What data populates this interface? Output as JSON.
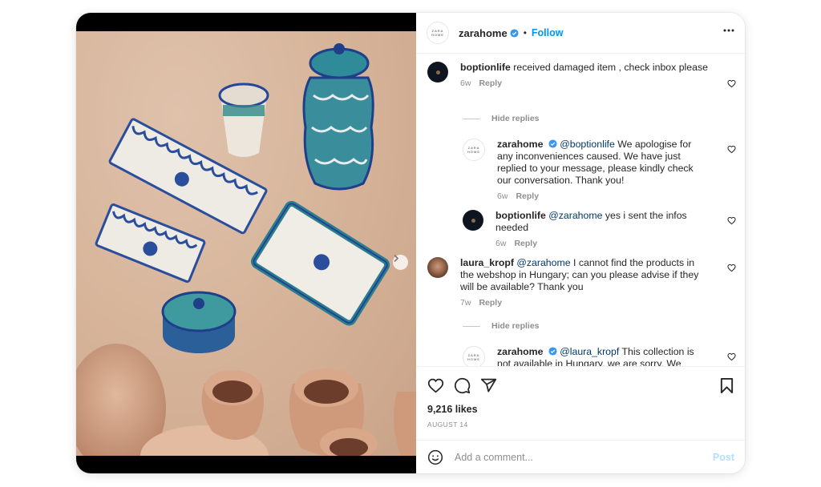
{
  "post": {
    "author": "zarahome",
    "author_avatar_text": [
      "ZARA",
      "HOME"
    ],
    "verified": true,
    "separator": "•",
    "follow_label": "Follow",
    "more_icon": "more-horizontal-icon",
    "image": {
      "description": "Blue and white hand-painted ceramics and terracotta pitchers on a beige stone surface",
      "current_slide": 1,
      "total_slides": 2
    }
  },
  "comments": [
    {
      "username": "boptionlife",
      "avatar": "dark-logo",
      "mention": "",
      "text": "received damaged item , check inbox please",
      "time": "6w",
      "reply_label": "Reply",
      "hide_replies_label": "Hide replies",
      "replies": [
        {
          "username": "zarahome",
          "verified": true,
          "mention": "@boptionlife",
          "text": "We apologise for any inconveniences caused. We have just replied to your message, please kindly check our conversation. Thank you!",
          "time": "6w",
          "reply_label": "Reply"
        },
        {
          "username": "boptionlife",
          "mention": "@zarahome",
          "text": "yes i sent the infos needed",
          "time": "6w",
          "reply_label": "Reply"
        }
      ]
    },
    {
      "username": "laura_kropf",
      "avatar": "photo",
      "mention": "@zarahome",
      "text": "I cannot find the products in the webshop in Hungary; can you please advise if they will be available? Thank you",
      "time": "7w",
      "reply_label": "Reply",
      "hide_replies_label": "Hide replies",
      "replies": [
        {
          "username": "zarahome",
          "verified": true,
          "mention": "@laura_kropf",
          "text": "This collection is not available in Hungary, we are sorry. We kindly advise you to subscribe to our newsletter to be up-to-date"
        }
      ]
    }
  ],
  "actions": {
    "like_icon": "heart-icon",
    "comment_icon": "comment-icon",
    "share_icon": "send-icon",
    "save_icon": "bookmark-icon"
  },
  "likes": "9,216 likes",
  "date": "AUGUST 14",
  "add_comment": {
    "placeholder": "Add a comment...",
    "value": "",
    "post_label": "Post"
  },
  "colors": {
    "accent": "#0095f6",
    "mention": "#00376b",
    "muted": "#8e8e8e",
    "post_disabled": "#b2dffc"
  }
}
